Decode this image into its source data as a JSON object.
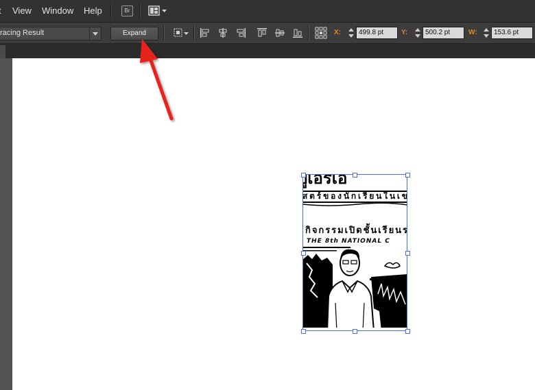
{
  "menu": {
    "partial_item": "t",
    "items": [
      "View",
      "Window",
      "Help"
    ],
    "bridge_label": "Br"
  },
  "control_bar": {
    "object_dropdown": "racing Result",
    "expand_label": "Expand",
    "x_label": "X:",
    "x_value": "499.8 pt",
    "y_label": "Y:",
    "y_value": "500.2 pt",
    "w_label": "W:",
    "w_value": "153.6 pt"
  },
  "artwork": {
    "headline_partial": "ปูเอรีเอื่",
    "line1": "สตร์ของนักเรียนในเข",
    "line2": "กิจกรรมเปิดชั้นเรียนร",
    "line3": "THE 8th NATIONAL C"
  },
  "colors": {
    "accent_selection": "#4a6ee0",
    "annotation_arrow": "#e8201a",
    "coord_label": "#e58a1f"
  }
}
